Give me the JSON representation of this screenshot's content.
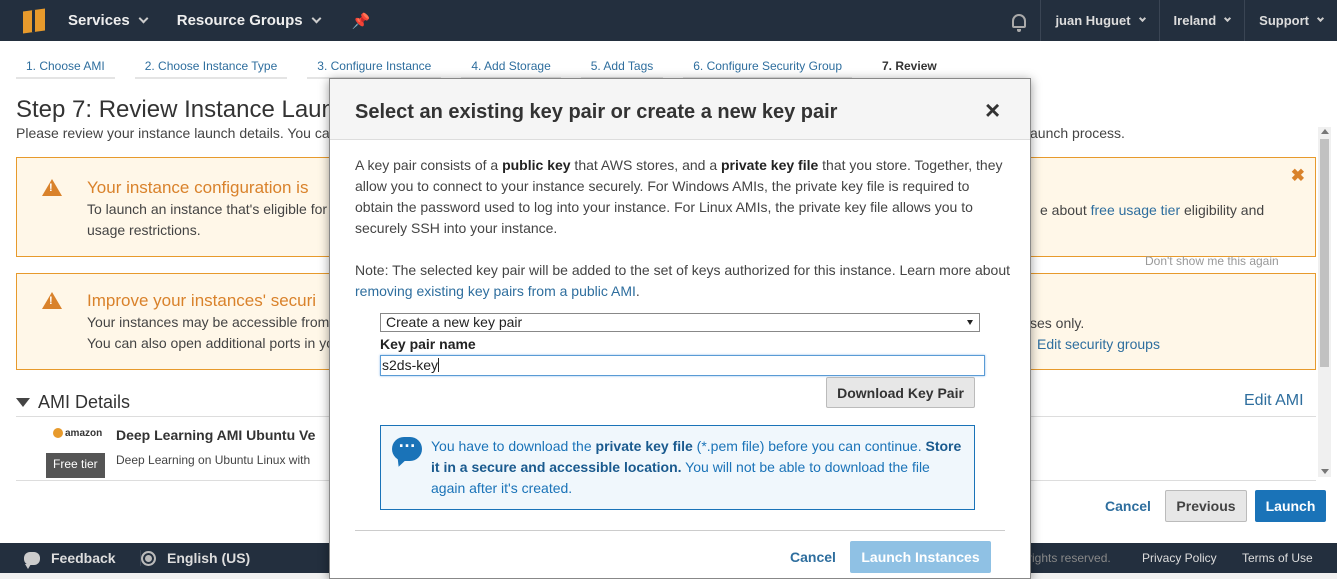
{
  "nav": {
    "services": "Services",
    "resource_groups": "Resource Groups",
    "user": "juan Huguet",
    "region": "Ireland",
    "support": "Support"
  },
  "steps": [
    {
      "label": "1. Choose AMI"
    },
    {
      "label": "2. Choose Instance Type"
    },
    {
      "label": "3. Configure Instance"
    },
    {
      "label": "4. Add Storage"
    },
    {
      "label": "5. Add Tags"
    },
    {
      "label": "6. Configure Security Group"
    },
    {
      "label": "7. Review"
    }
  ],
  "background": {
    "title": "Step 7: Review Instance Laun",
    "subtitle": "Please review your instance launch details. You ca",
    "subtitle_right": "aunch process.",
    "warning1": {
      "title": "Your instance configuration is",
      "text_line1": "To launch an instance that's eligible for",
      "text_line2": "usage restrictions.",
      "right_prefix": "e about",
      "right_link": "free usage tier",
      "right_suffix": "eligibility and"
    },
    "dont_show": "Don't show me this again",
    "warning2": {
      "title": "Improve your instances' securi",
      "text_line1": "Your instances may be accessible from",
      "text_line2": "You can also open additional ports in yo",
      "right1": "ses only.",
      "right_link": "Edit security groups"
    },
    "ami_heading": "AMI Details",
    "edit_ami": "Edit AMI",
    "amazon_logo": "amazon",
    "free_tier": "Free tier",
    "ami_name": "Deep Learning AMI Ubuntu Ve",
    "ami_desc": "Deep Learning on Ubuntu Linux with",
    "cancel": "Cancel",
    "previous": "Previous",
    "launch": "Launch"
  },
  "footer": {
    "feedback": "Feedback",
    "language": "English (US)",
    "rights": "rights reserved.",
    "privacy": "Privacy Policy",
    "terms": "Terms of Use"
  },
  "modal": {
    "title": "Select an existing key pair or create a new key pair",
    "close": "×",
    "p1_a": "A key pair consists of a ",
    "p1_b": "public key",
    "p1_c": " that AWS stores, and a ",
    "p1_d": "private key file",
    "p1_e": " that you store. Together, they allow you to connect to your instance securely. For Windows AMIs, the private key file is required to obtain the password used to log into your instance. For Linux AMIs, the private key file allows you to securely SSH into your instance.",
    "p2_a": "Note: The selected key pair will be added to the set of keys authorized for this instance. Learn more about ",
    "p2_link": "removing existing key pairs from a public AMI",
    "p2_b": ".",
    "select_value": "Create a new key pair",
    "key_label": "Key pair name",
    "key_value": "s2ds-key",
    "download_btn": "Download Key Pair",
    "info_a": "You have to download the ",
    "info_b": "private key file",
    "info_c": " (*.pem file) before you can continue. ",
    "info_d": "Store it in a secure and accessible location.",
    "info_e": " You will not be able to download the file again after it's created.",
    "cancel": "Cancel",
    "launch_instances": "Launch Instances"
  }
}
